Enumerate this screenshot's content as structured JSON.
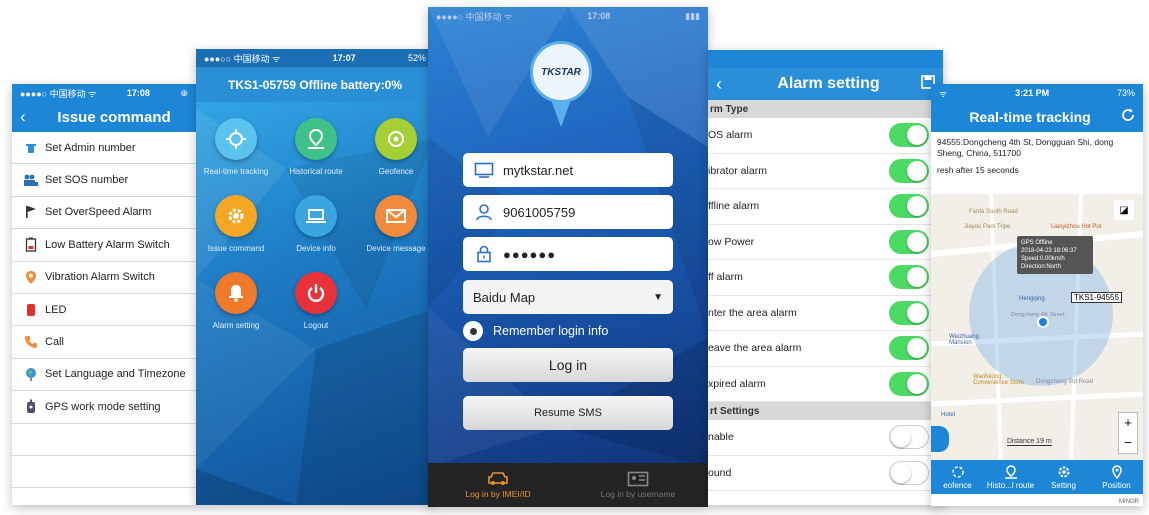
{
  "phone1": {
    "status": {
      "carrier": "●●●●○ 中国移动 ᯤ",
      "time": "17:08"
    },
    "title": "Issue command",
    "back": "‹",
    "items": [
      {
        "label": "Set Admin number",
        "icon": "phone-icon"
      },
      {
        "label": "Set SOS number",
        "icon": "people-icon"
      },
      {
        "label": "Set OverSpeed Alarm",
        "icon": "flag-icon"
      },
      {
        "label": "Low Battery Alarm Switch",
        "icon": "battery-icon"
      },
      {
        "label": "Vibration Alarm Switch",
        "icon": "pin-icon"
      },
      {
        "label": "LED",
        "icon": "led-icon"
      },
      {
        "label": "Call",
        "icon": "call-icon"
      },
      {
        "label": "Set Language and Timezone",
        "icon": "globe-icon"
      },
      {
        "label": "GPS work mode setting",
        "icon": "gps-icon"
      }
    ]
  },
  "phone2": {
    "status": {
      "carrier": "●●●○○ 中国移动 ᯤ",
      "time": "17:07",
      "battery": "52%"
    },
    "title": "TKS1-05759 Offline battery:0%",
    "tiles": [
      {
        "label": "Real-time tracking",
        "color": "#5cc3ef",
        "icon": "crosshair-icon"
      },
      {
        "label": "Historical route",
        "color": "#3fc28a",
        "icon": "route-icon"
      },
      {
        "label": "Geofence",
        "color": "#a6cf35",
        "icon": "geofence-icon"
      },
      {
        "label": "Issue command",
        "color": "#f5a623",
        "icon": "gear-icon"
      },
      {
        "label": "Device info",
        "color": "#3aa5e0",
        "icon": "laptop-icon"
      },
      {
        "label": "Device message",
        "color": "#f28a3c",
        "icon": "mail-icon"
      },
      {
        "label": "Alarm setting",
        "color": "#f07a2c",
        "icon": "bell-icon"
      },
      {
        "label": "Logout",
        "color": "#e8323a",
        "icon": "power-icon"
      }
    ]
  },
  "phone3": {
    "status": {
      "carrier": "●●●●○ 中国移动 ᯤ",
      "time": "17:08"
    },
    "logo": "TKSTAR",
    "server": "mytkstar.net",
    "account": "9061005759",
    "password": "●●●●●●",
    "map_type": "Baidu Map",
    "remember": "Remember login info",
    "login": "Log in",
    "resume": "Resume SMS",
    "tabs": [
      "Log in by IMEI/ID",
      "Log in by username"
    ]
  },
  "phone4": {
    "title": "Alarm setting",
    "back": "‹",
    "section1": "rm Type",
    "alarms": [
      {
        "label": "OS alarm",
        "on": true
      },
      {
        "label": "ibrator alarm",
        "on": true
      },
      {
        "label": "ffline alarm",
        "on": true
      },
      {
        "label": "ow Power",
        "on": true
      },
      {
        "label": "ff alarm",
        "on": true
      },
      {
        "label": "nter the area alarm",
        "on": true
      },
      {
        "label": "eave the area alarm",
        "on": true
      },
      {
        "label": "xpired alarm",
        "on": true
      }
    ],
    "section2": "rt Settings",
    "alerts": [
      {
        "label": "nable",
        "on": false
      },
      {
        "label": "ound",
        "on": false
      }
    ],
    "accent": "#4cd964"
  },
  "phone5": {
    "status": {
      "time": "3:21 PM",
      "battery": "73%"
    },
    "title": "Real-time tracking",
    "address": "94555:Dongcheng 4th St, Dongguan Shi, dong Sheng, China, 511700",
    "refresh": "resh after 15 seconds",
    "popup": [
      "GPS Offline",
      "2018-04-23 18:06:37",
      "Speed:0.00km/h",
      "Direction:North"
    ],
    "device_label": "TKS1-94555",
    "distance": "Distance 19 m",
    "map_labels": [
      "Jiayou Park Tripe",
      "Hengqing",
      "Wanfulong Convenience Store",
      "Dongcheng 3rd Road",
      "Weizhuang Mansion",
      "Liaoyizhou Hot Pot",
      "Fanta South Road",
      "Hotel",
      "Dongcheng 4th Street"
    ],
    "nav": [
      "eofence",
      "Histo...l route",
      "Setting",
      "Position"
    ],
    "watermark": "MINOR"
  }
}
